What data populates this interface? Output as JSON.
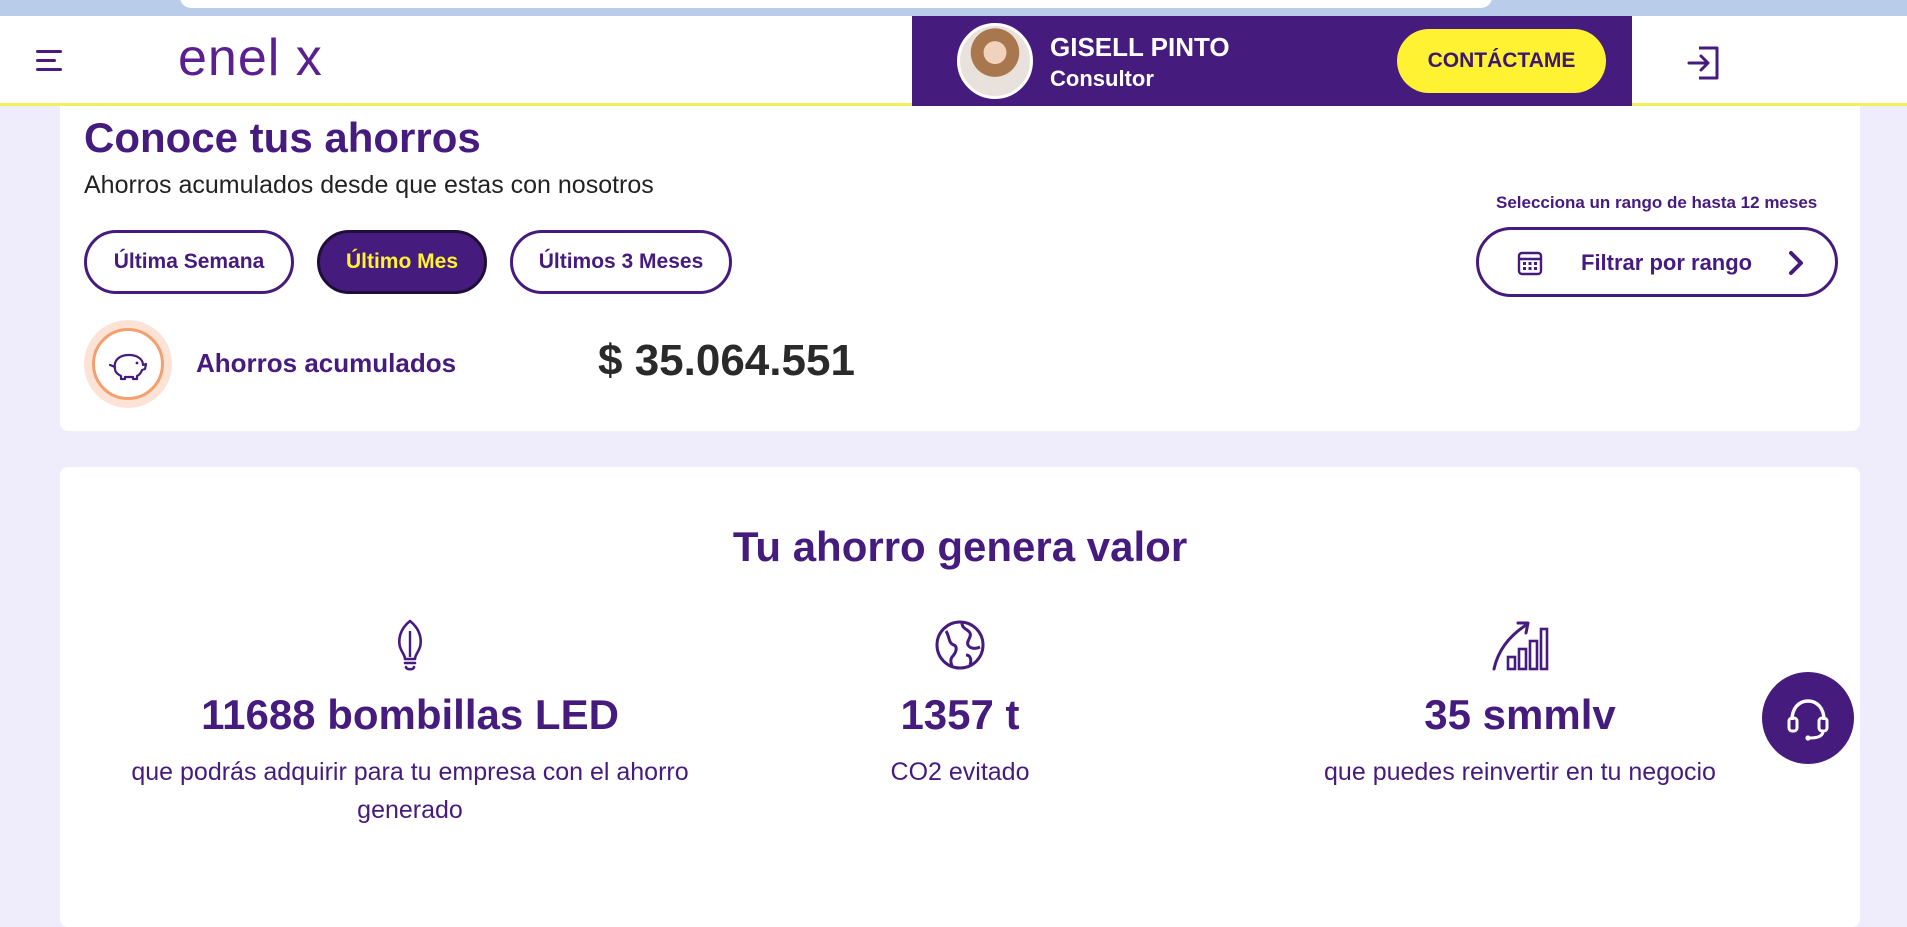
{
  "header": {
    "logo_text": "enel x",
    "consultant_name": "GISELL PINTO",
    "consultant_role": "Consultor",
    "contact_label": "CONTÁCTAME"
  },
  "savings_card": {
    "title": "Conoce tus ahorros",
    "subtitle": "Ahorros acumulados desde que estas con nosotros",
    "filters": [
      {
        "label": "Última Semana",
        "active": false
      },
      {
        "label": "Último Mes",
        "active": true
      },
      {
        "label": "Últimos 3 Meses",
        "active": false
      }
    ],
    "range_hint": "Selecciona un rango de hasta 12 meses",
    "range_button_label": "Filtrar por rango",
    "accumulated_label": "Ahorros acumulados",
    "accumulated_value": "$ 35.064.551"
  },
  "value_card": {
    "heading": "Tu ahorro genera valor",
    "stats": [
      {
        "icon": "bulb-icon",
        "value": "11688 bombillas LED",
        "description": "que podrás adquirir para tu empresa con el ahorro generado"
      },
      {
        "icon": "globe-icon",
        "value": "1357 t",
        "description": "CO2 evitado"
      },
      {
        "icon": "growth-chart-icon",
        "value": "35 smmlv",
        "description": "que puedes reinvertir en tu negocio"
      }
    ]
  },
  "colors": {
    "brand_purple": "#461b7e",
    "accent_yellow": "#fff232",
    "page_background": "#efedfb"
  }
}
